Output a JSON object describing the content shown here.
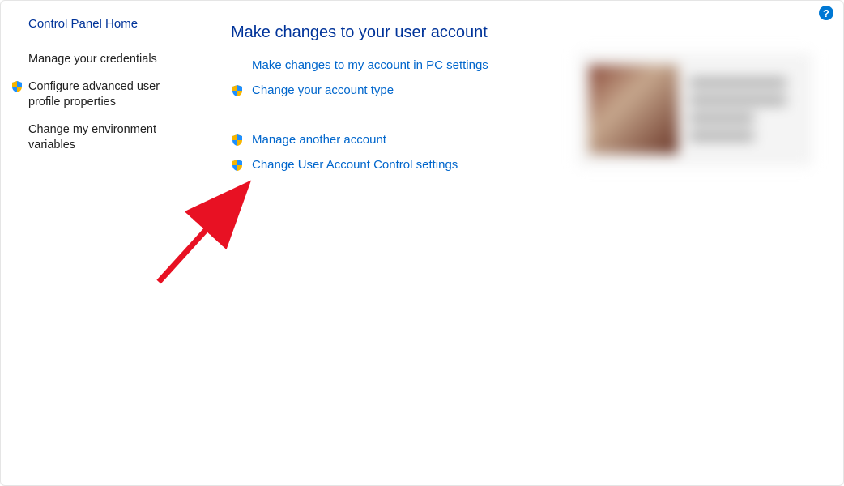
{
  "help_icon_label": "?",
  "sidebar": {
    "title": "Control Panel Home",
    "links": [
      {
        "label": "Manage your credentials",
        "shield": false
      },
      {
        "label": "Configure advanced user profile properties",
        "shield": true
      },
      {
        "label": "Change my environment variables",
        "shield": false
      }
    ]
  },
  "main": {
    "title": "Make changes to your user account",
    "links_group1": [
      {
        "label": "Make changes to my account in PC settings",
        "shield": false,
        "indented": true
      },
      {
        "label": "Change your account type",
        "shield": true,
        "indented": false
      }
    ],
    "links_group2": [
      {
        "label": "Manage another account",
        "shield": true,
        "indented": false
      },
      {
        "label": "Change User Account Control settings",
        "shield": true,
        "indented": false
      }
    ]
  }
}
